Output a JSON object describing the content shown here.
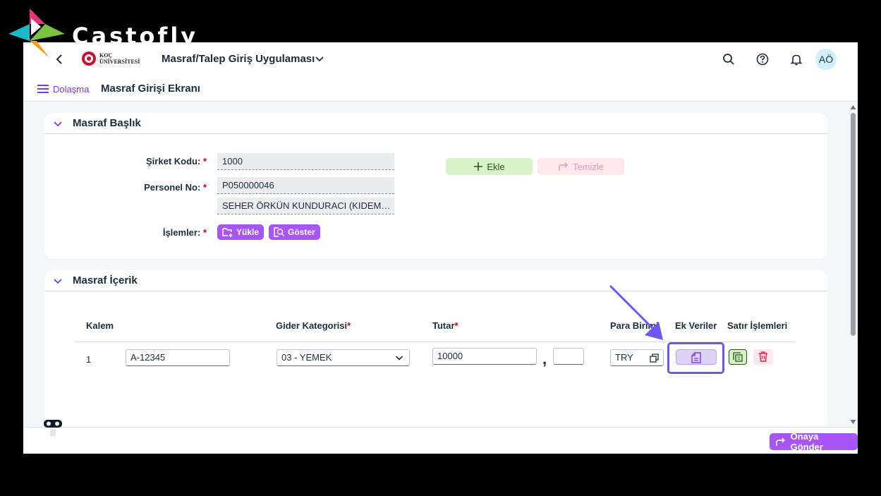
{
  "brand": {
    "name": "Castofly"
  },
  "shell": {
    "logo_line1": "KOÇ",
    "logo_line2": "ÜNİVERSİTESİ",
    "app_title": "Masraf/Talep Giriş Uygulaması",
    "avatar_initials": "AÖ"
  },
  "subbar": {
    "nav_label": "Dolaşma",
    "page_title": "Masraf Girişi Ekranı"
  },
  "header_panel": {
    "title": "Masraf Başlık",
    "company_code_label": "Şirket Kodu:",
    "company_code_value": "1000",
    "personnel_no_label": "Personel No:",
    "personnel_no_value": "P050000046",
    "personnel_name_value": "SEHER ÖRKÜN KUNDURACI (KIDEMLI...",
    "operations_label": "İşlemler:",
    "upload_label": "Yükle",
    "show_label": "Göster",
    "add_label": "Ekle",
    "clear_label": "Temizle",
    "required_mark": "*"
  },
  "content_panel": {
    "title": "Masraf İçerik",
    "columns": {
      "kalem": "Kalem",
      "category": "Gider Kategorisi",
      "amount": "Tutar",
      "currency": "Para Birimi",
      "extra": "Ek Veriler",
      "row_ops": "Satır İşlemleri"
    },
    "row": {
      "index": "1",
      "kalem_value": "A-12345",
      "category_value": "03 - YEMEK",
      "amount_value": "10000",
      "decimal_separator": ",",
      "decimal_value": "",
      "currency_value": "TRY"
    }
  },
  "footer": {
    "send_label": "Onaya Gönder"
  },
  "colors": {
    "accent": "#a855f7",
    "highlight": "#6d55f6",
    "add_bg": "#d9f2c9",
    "clear_bg": "#fde8ee"
  }
}
